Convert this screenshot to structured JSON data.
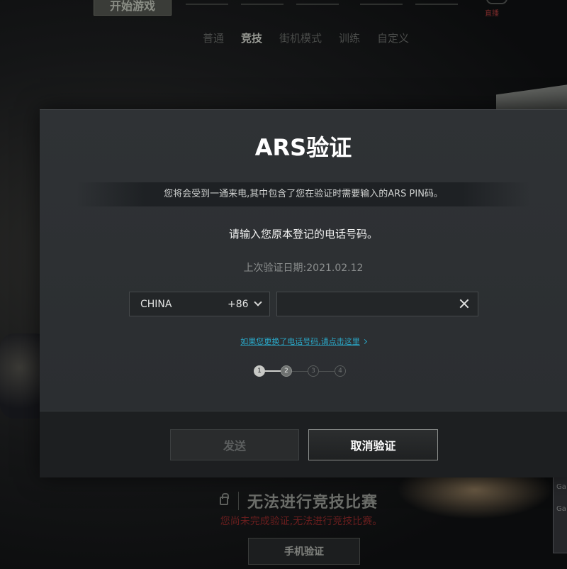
{
  "background": {
    "start_tab": "开始游戏",
    "top_nav": [
      "",
      "",
      "",
      "",
      ""
    ],
    "live_label": "直播",
    "modes": [
      {
        "label": "普通",
        "active": false
      },
      {
        "label": "竞技",
        "active": true
      },
      {
        "label": "街机模式",
        "active": false
      },
      {
        "label": "训练",
        "active": false
      },
      {
        "label": "自定义",
        "active": false
      }
    ],
    "cannot_play": "无法进行竞技比赛",
    "warning": "您尚未完成验证,无法进行竞技比赛。",
    "phone_verify_button": "手机验证",
    "right_panel": [
      "",
      "Ga",
      "Ga"
    ]
  },
  "modal": {
    "title": "ARS验证",
    "info": "您将会受到一通来电,其中包含了您在验证时需要输入的ARS PIN码。",
    "prompt": "请输入您原本登记的电话号码。",
    "last_date": "上次验证日期:2021.02.12",
    "country": {
      "name": "CHINA",
      "code": "+86"
    },
    "phone_input": {
      "value": "",
      "placeholder": ""
    },
    "change_link": "如果您更换了电话号码,请点击这里",
    "steps": [
      {
        "label": "1",
        "state": "done"
      },
      {
        "label": "2",
        "state": "current"
      },
      {
        "label": "3",
        "state": "pending"
      },
      {
        "label": "4",
        "state": "pending"
      }
    ],
    "send_button": "发送",
    "cancel_button": "取消验证"
  },
  "colors": {
    "accent_link": "#2aa7c7",
    "warning_red": "#6a1e1e",
    "modal_bg": "#2f3235"
  }
}
